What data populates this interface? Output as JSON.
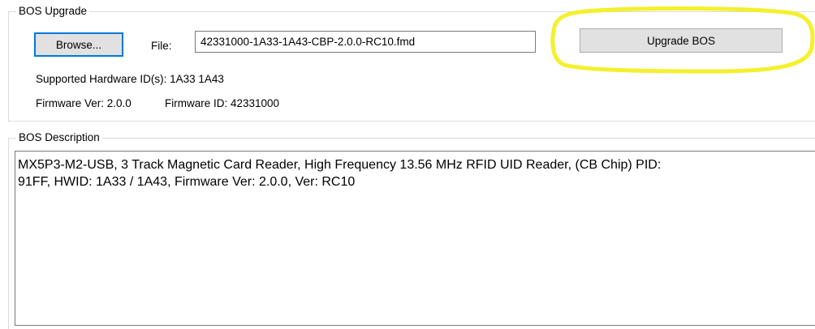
{
  "bos_upgrade": {
    "group_title": "BOS Upgrade",
    "browse_label": "Browse...",
    "file_label": "File:",
    "file_value": "42331000-1A33-1A43-CBP-2.0.0-RC10.fmd",
    "upgrade_label": "Upgrade BOS",
    "hardware_ids_text": "Supported Hardware ID(s):  1A33 1A43",
    "firmware_ver_text": "Firmware Ver: 2.0.0",
    "firmware_id_text": "Firmware ID: 42331000"
  },
  "bos_description": {
    "group_title": "BOS Description",
    "lines": [
      "MX5P3-M2-USB, 3 Track Magnetic Card Reader, High Frequency 13.56 MHz RFID UID Reader, (CB Chip) PID:",
      "91FF, HWID: 1A33 / 1A43,  Firmware Ver: 2.0.0, Ver: RC10"
    ]
  },
  "annotation": {
    "highlight_color": "#f4f02c"
  },
  "colors": {
    "focus_border": "#0078d7",
    "button_face": "#e1e1e1",
    "group_border": "#dcdcdc"
  }
}
